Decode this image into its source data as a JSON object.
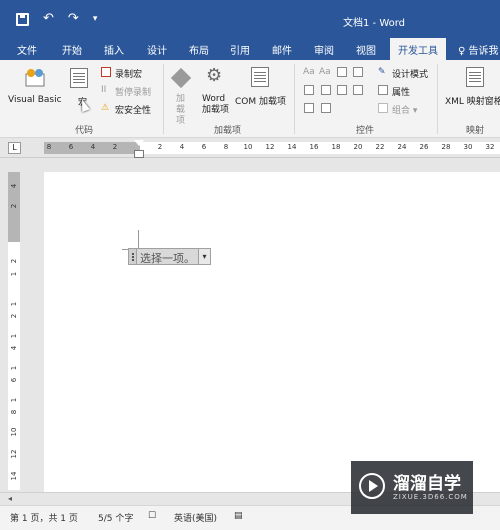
{
  "title_bar": {
    "title": "文档1 - Word",
    "undo_label": "↶",
    "redo_label": "↷",
    "more_label": "▾"
  },
  "tabs": [
    {
      "label": "文件"
    },
    {
      "label": "开始"
    },
    {
      "label": "插入"
    },
    {
      "label": "设计"
    },
    {
      "label": "布局"
    },
    {
      "label": "引用"
    },
    {
      "label": "邮件"
    },
    {
      "label": "审阅"
    },
    {
      "label": "视图"
    },
    {
      "label": "开发工具"
    },
    {
      "label": "♀ 告诉我"
    }
  ],
  "ribbon": {
    "code": {
      "visual_basic": "Visual Basic",
      "macro": "宏",
      "record_macro": "录制宏",
      "pause_record": "暂停录制",
      "macro_security": "宏安全性",
      "group": "代码"
    },
    "addins": {
      "add_in": "加载项",
      "word_addins": "Word 加载项",
      "com_addins": "COM 加载项",
      "group": "加载项"
    },
    "controls": {
      "design_mode": "设计模式",
      "properties": "属性",
      "group_btn": "组合 ▾",
      "group": "控件"
    },
    "mapping": {
      "xml": "XML 映射窗格",
      "group": "映射"
    }
  },
  "ruler": {
    "corner": "L",
    "h_marks": [
      "8",
      "6",
      "4",
      "2",
      "2",
      "4",
      "6",
      "8",
      "10",
      "12",
      "14",
      "16",
      "18",
      "20",
      "22",
      "24",
      "26",
      "28",
      "30",
      "32"
    ],
    "v_marks": [
      "4",
      "2",
      "2",
      "1",
      "1",
      "2",
      "1",
      "4",
      "1",
      "6",
      "1",
      "8",
      "10",
      "12",
      "14"
    ]
  },
  "document": {
    "content_control_placeholder": "选择一项。",
    "dropdown_arrow": "▾"
  },
  "status": {
    "page": "第 1 页，共 1 页",
    "words": "5/5 个字",
    "language": "英语(美国)"
  },
  "watermark": {
    "brand": "溜溜自学",
    "url": "ZIXUE.3D66.COM"
  }
}
